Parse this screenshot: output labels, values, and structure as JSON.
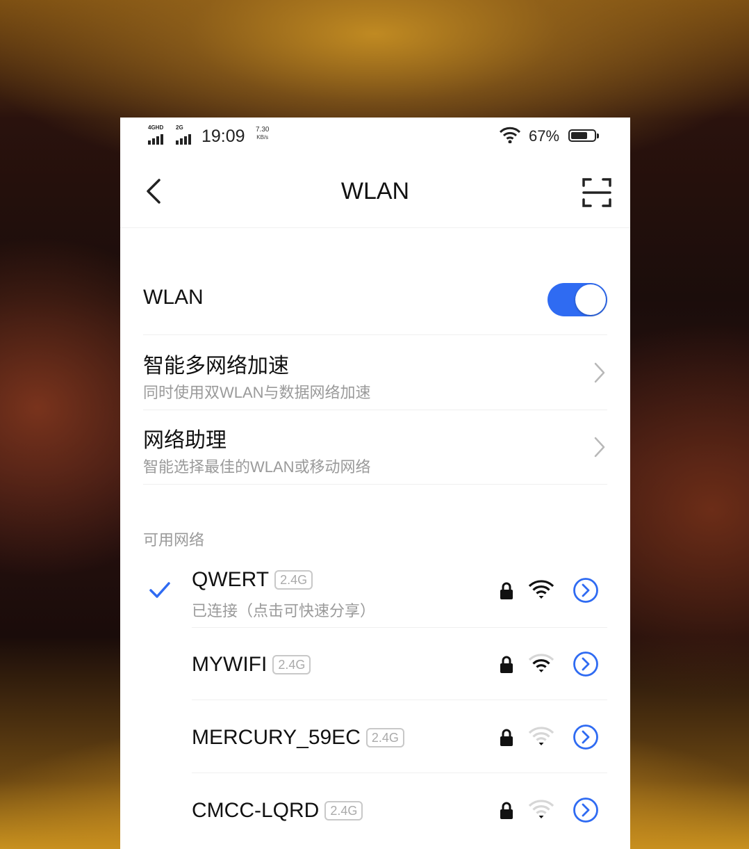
{
  "status_bar": {
    "sim1_label": "4GHD",
    "sim2_label": "2G",
    "time": "19:09",
    "speed_value": "7.30",
    "speed_unit": "KB/s",
    "battery_percent": "67%"
  },
  "header": {
    "title": "WLAN",
    "back_icon": "chevron-left-icon",
    "scan_icon": "scan-frame-icon"
  },
  "wlan_toggle": {
    "label": "WLAN",
    "enabled": true,
    "accent_color": "#2f6bf2"
  },
  "settings": [
    {
      "title": "智能多网络加速",
      "subtitle": "同时使用双WLAN与数据网络加速"
    },
    {
      "title": "网络助理",
      "subtitle": "智能选择最佳的WLAN或移动网络"
    }
  ],
  "available_label": "可用网络",
  "networks": [
    {
      "name": "QWERT",
      "band": "2.4G",
      "status": "已连接（点击可快速分享）",
      "connected": true,
      "secured": true,
      "signal": 4
    },
    {
      "name": "MYWIFI",
      "band": "2.4G",
      "status": "",
      "connected": false,
      "secured": true,
      "signal": 3
    },
    {
      "name": "MERCURY_59EC",
      "band": "2.4G",
      "status": "",
      "connected": false,
      "secured": true,
      "signal": 1
    },
    {
      "name": "CMCC-LQRD",
      "band": "2.4G",
      "status": "",
      "connected": false,
      "secured": true,
      "signal": 1
    }
  ]
}
